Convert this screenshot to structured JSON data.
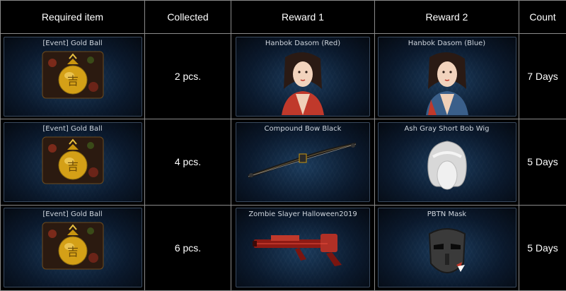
{
  "headers": {
    "required": "Required item",
    "collected": "Collected",
    "reward1": "Reward 1",
    "reward2": "Reward 2",
    "count": "Count"
  },
  "rows": [
    {
      "required": "[Event] Gold Ball",
      "collected": "2 pcs.",
      "reward1": "Hanbok Dasom (Red)",
      "reward2": "Hanbok Dasom (Blue)",
      "count": "7 Days"
    },
    {
      "required": "[Event] Gold Ball",
      "collected": "4 pcs.",
      "reward1": "Compound Bow Black",
      "reward2": "Ash Gray Short Bob Wig",
      "count": "5 Days"
    },
    {
      "required": "[Event] Gold Ball",
      "collected": "6 pcs.",
      "reward1": "Zombie Slayer Halloween2019",
      "reward2": "PBTN Mask",
      "count": "5 Days"
    }
  ],
  "colors": {
    "background": "#000000",
    "border": "#8a8a8a",
    "text": "#ffffff",
    "gold": "#d4a017",
    "red_accent": "#c0392b"
  },
  "icons": [
    "gold-ball-icon",
    "hanbok-red-icon",
    "hanbok-blue-icon",
    "compound-bow-icon",
    "wig-icon",
    "zombie-slayer-gun-icon",
    "pbtn-mask-icon"
  ]
}
